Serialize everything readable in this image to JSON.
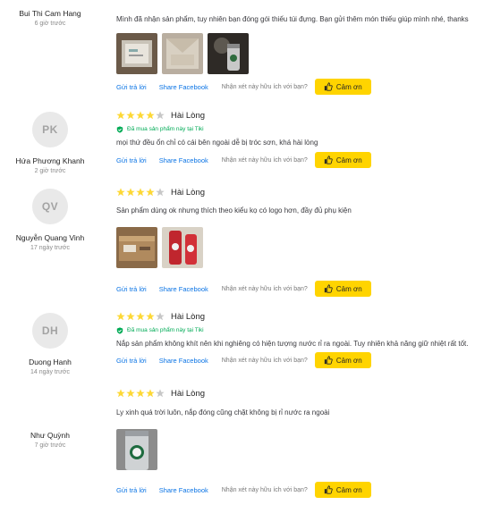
{
  "common": {
    "reply_label": "Gửi trả lời",
    "share_label": "Share Facebook",
    "helpful_question": "Nhận xét này hữu ích với bạn?",
    "thanks_label": "Cảm ơn",
    "verified_label": "Đã mua sản phẩm này tại Tiki",
    "star_color": "#fdd836",
    "star_empty_color": "#c7c7c7",
    "verified_color": "#00ab56",
    "link_color": "#0b74e5",
    "thanks_bg": "#ffd400"
  },
  "reviews": [
    {
      "user_name": "Bui Thi Cam Hang",
      "time": "6 giờ trước",
      "content": "Mình đã nhận sản phẩm, tuy nhiên bạn đóng gói thiếu túi đựng. Bạn gửi thêm món thiếu giúp mình nhé, thanks",
      "photos": [
        "photo-box-open",
        "photo-package",
        "photo-tumbler"
      ]
    },
    {
      "initials": "PK",
      "user_name": "Hứa Phương Khanh",
      "time": "2 giờ trước",
      "rating": 4,
      "rating_title": "Hài Lòng",
      "content": "mọi thứ đều ổn chỉ có cái bên ngoài dễ bị tróc sơn, khá hài lòng"
    },
    {
      "initials": "QV",
      "user_name": "Nguyễn Quang Vinh",
      "time": "17 ngày trước",
      "rating": 4,
      "rating_title": "Hài Lòng",
      "content": "Sản phẩm dùng ok nhưng thích theo kiểu kọ có logo hơn, đầy đủ phụ kiện",
      "photos": [
        "photo-cardboard-box",
        "photo-red-tumbler"
      ]
    },
    {
      "initials": "DH",
      "user_name": "Duong Hanh",
      "time": "14 ngày trước",
      "rating": 4,
      "rating_title": "Hài Lòng",
      "content": "Nắp sản phẩm không khít nên khi nghiêng có hiện tượng nước rỉ ra ngoài. Tuy nhiên khả năng giữ nhiệt rất tốt."
    },
    {
      "user_name": "Như Quỳnh",
      "time": "7 giờ trước",
      "rating": 4,
      "rating_title": "Hài Lòng",
      "content": "Ly xinh quá trời luôn, nắp đóng cũng chặt không bị rỉ nước ra ngoài",
      "photos": [
        "photo-starbucks-tumbler"
      ]
    }
  ]
}
